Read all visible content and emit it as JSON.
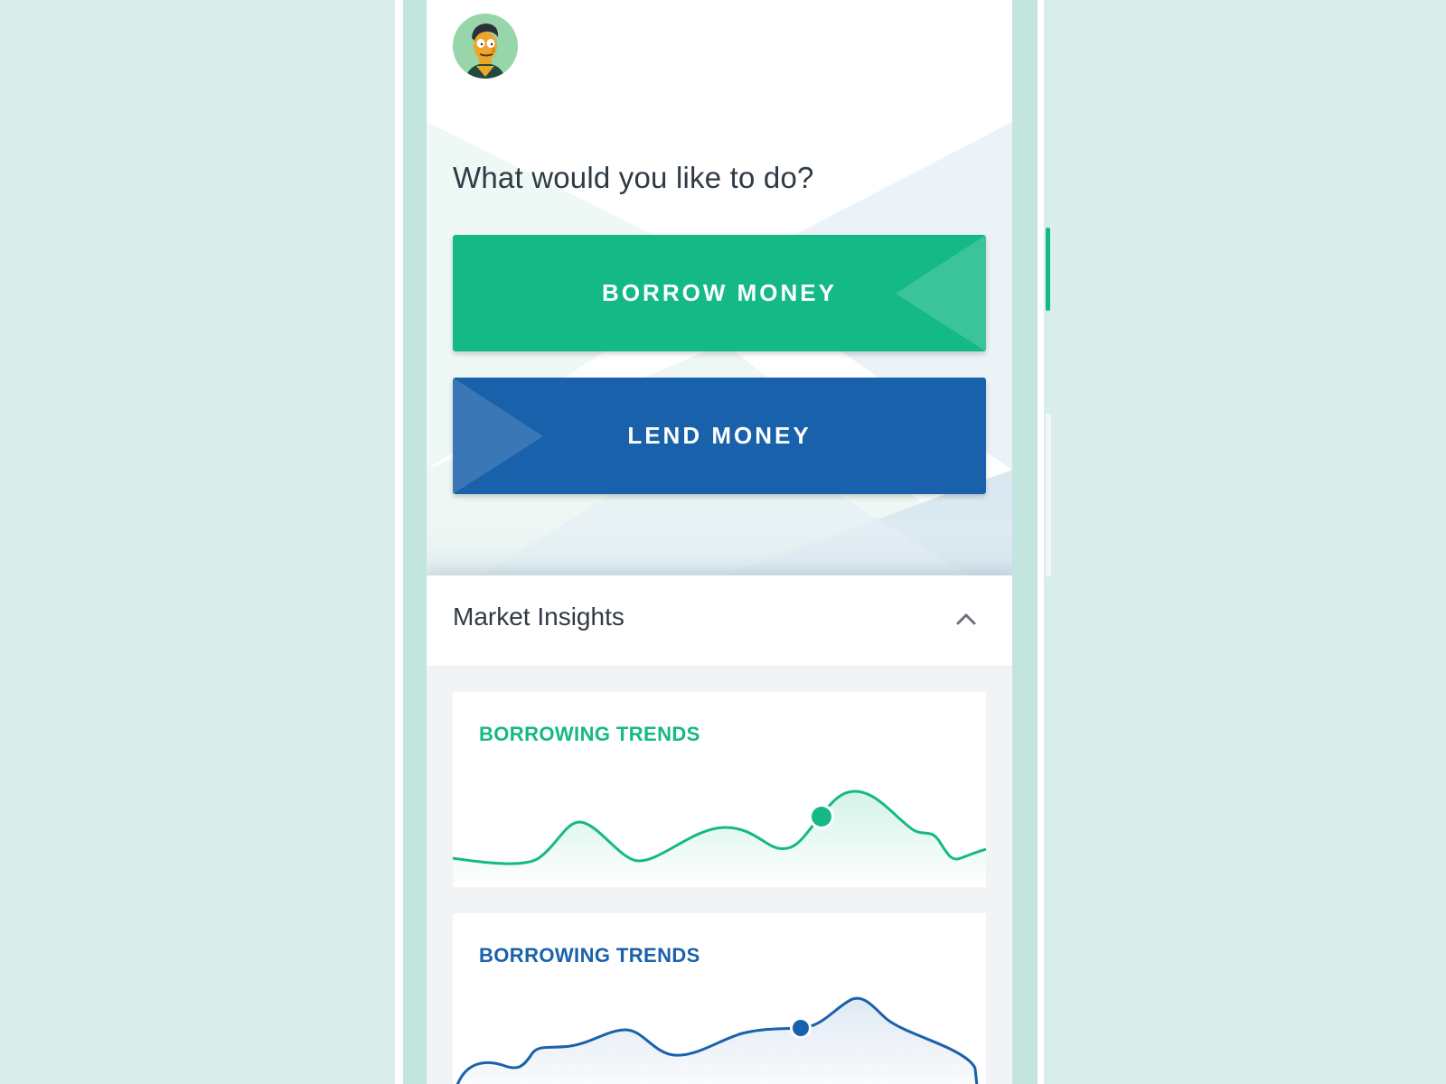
{
  "home": {
    "prompt": "What would you like to do?",
    "avatar_icon": "user-avatar-icon",
    "actions": [
      {
        "label": "BORROW MONEY",
        "color": "#14b985"
      },
      {
        "label": "LEND MONEY",
        "color": "#1a61ab"
      }
    ]
  },
  "insights": {
    "title": "Market Insights",
    "toggle_icon": "chevron-up-icon",
    "cards": [
      {
        "title": "BORROWING TRENDS",
        "color": "#14b985"
      },
      {
        "title": "BORROWING TRENDS",
        "color": "#1a61ab"
      }
    ]
  },
  "theme": {
    "background": "#d9eeea",
    "frame": "#c2e5de",
    "accent_green": "#14b985",
    "accent_blue": "#1a61ab",
    "text": "#2e3a45"
  }
}
